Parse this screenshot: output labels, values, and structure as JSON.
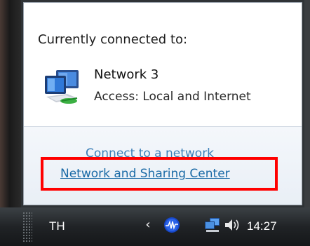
{
  "popup": {
    "heading": "Currently connected to:",
    "network": {
      "name": "Network  3",
      "access": "Access:  Local and Internet",
      "icon": "network-computer-icon"
    },
    "links": {
      "connect": "Connect to a network",
      "sharing_center": "Network and Sharing Center"
    },
    "highlight_color": "#ff0000"
  },
  "taskbar": {
    "language": "TH",
    "tray_icons": [
      "chevron-left-icon",
      "wave-icon",
      "network-tray-icon",
      "volume-icon"
    ],
    "clock": "14:27"
  }
}
